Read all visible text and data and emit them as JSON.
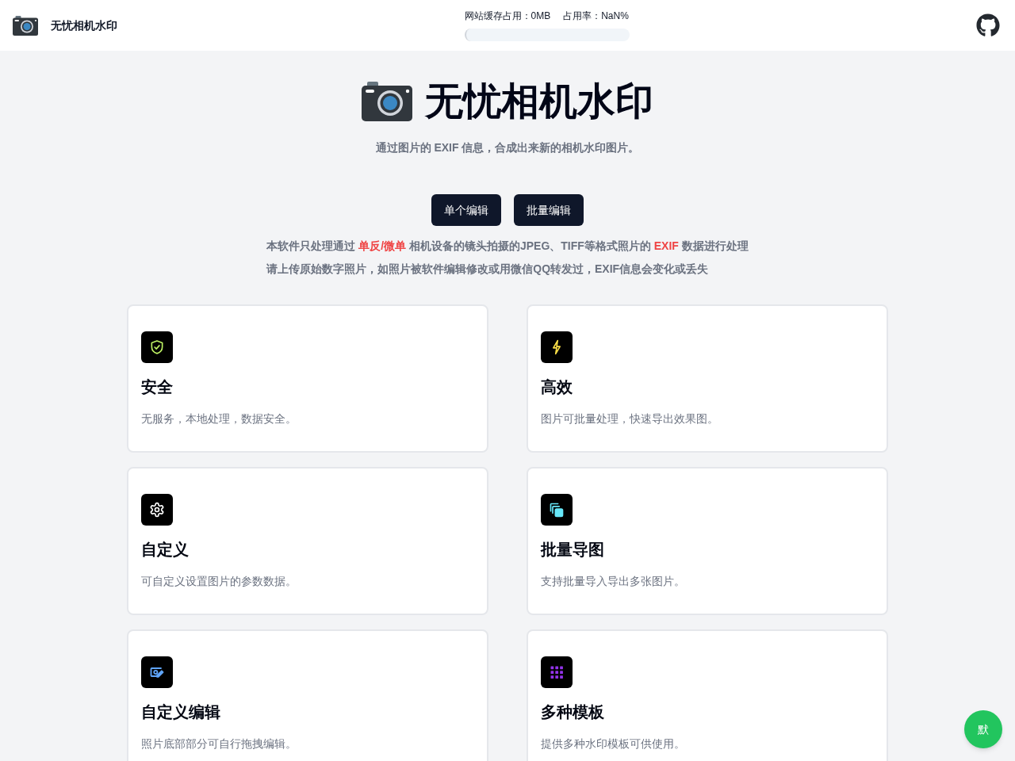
{
  "header": {
    "title": "无忧相机水印",
    "cache_usage": "网站缓存占用：0MB",
    "usage_rate": "占用率：NaN%",
    "usage_bar": {
      "level": 0
    }
  },
  "hero": {
    "title": "无忧相机水印",
    "subtitle": "通过图片的 EXIF 信息，合成出来新的相机水印图片。"
  },
  "buttons": [
    "单个编辑",
    "批量编辑"
  ],
  "notice": [
    {
      "segments": [
        {
          "text": "本软件只处理通过 ",
          "highlight": false
        },
        {
          "text": "单反/微单",
          "highlight": true
        },
        {
          "text": " 相机设备的镜头拍摄的JPEG、TIFF等格式照片的 ",
          "highlight": false
        },
        {
          "text": "EXIF",
          "highlight": true
        },
        {
          "text": " 数据进行处理",
          "highlight": false
        }
      ]
    },
    {
      "segments": [
        {
          "text": "请上传原始数字照片，如照片被软件编辑修改或用微信QQ转发过，EXIF信息会变化或丢失",
          "highlight": false
        }
      ]
    }
  ],
  "features": [
    {
      "title": "安全",
      "description": "无服务，本地处理，数据安全。",
      "color": "#bef264"
    },
    {
      "title": "高效",
      "description": "图片可批量处理，快速导出效果图。",
      "color": "#fde047"
    },
    {
      "title": "自定义",
      "description": "可自定义设置图片的参数数据。",
      "color": "#ffffff"
    },
    {
      "title": "批量导图",
      "description": "支持批量导入导出多张图片。",
      "color": "#67e8f9"
    },
    {
      "title": "自定义编辑",
      "description": "照片底部部分可自行拖拽编辑。",
      "color": "#60a5fa"
    },
    {
      "title": "多种模板",
      "description": "提供多种水印模板可供使用。",
      "color": "#9333ea"
    }
  ],
  "floating_button": "默"
}
